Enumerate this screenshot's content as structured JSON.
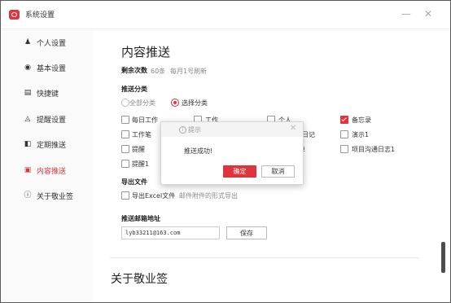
{
  "window": {
    "title": "系统设置",
    "minimize": "—",
    "close": "✕"
  },
  "sidebar": {
    "items": [
      {
        "label": "个人设置",
        "icon": "person-icon",
        "glyph": "♟"
      },
      {
        "label": "基本设置",
        "icon": "settings-icon",
        "glyph": "◉"
      },
      {
        "label": "快捷键",
        "icon": "keyboard-icon",
        "glyph": "▤"
      },
      {
        "label": "提醒设置",
        "icon": "bell-icon",
        "glyph": "◬"
      },
      {
        "label": "定期推送",
        "icon": "schedule-icon",
        "glyph": "◧"
      },
      {
        "label": "内容推送",
        "icon": "push-icon",
        "glyph": "▣",
        "active": true
      },
      {
        "label": "关于敬业签",
        "icon": "info-icon",
        "glyph": "ⓘ"
      }
    ]
  },
  "main": {
    "heading": "内容推送",
    "remaining": {
      "label": "剩余次数",
      "count": "60条",
      "refresh": "每月1号刷新"
    },
    "category": {
      "label": "推送分类",
      "options": [
        "全部分类",
        "选择分类"
      ],
      "selected": "选择分类",
      "items": [
        {
          "label": "每日工作",
          "checked": false
        },
        {
          "label": "工作",
          "checked": false
        },
        {
          "label": "个人",
          "checked": false
        },
        {
          "label": "备忘录",
          "checked": true
        },
        {
          "label": "工作笔",
          "checked": false
        },
        {
          "label": "日记",
          "checked": false
        },
        {
          "label": "演示1",
          "checked": false
        },
        {
          "label": "提醒",
          "checked": false
        },
        {
          "label": "单",
          "checked": false
        },
        {
          "label": "项目沟通日志1",
          "checked": false
        },
        {
          "label": "提醒1",
          "checked": false
        }
      ]
    },
    "export": {
      "label": "导出文件",
      "option": "导出Excel文件",
      "hint": "邮件附件的形式导出",
      "checked": false
    },
    "email": {
      "label": "推送邮箱地址",
      "value": "lyb33211@163.com",
      "save": "保存"
    },
    "about_heading": "关于敬业签"
  },
  "dialog": {
    "title": "提示",
    "message": "推送成功!",
    "confirm": "确定",
    "cancel": "取消",
    "close": "✕"
  },
  "colors": {
    "accent": "#e0343c"
  }
}
